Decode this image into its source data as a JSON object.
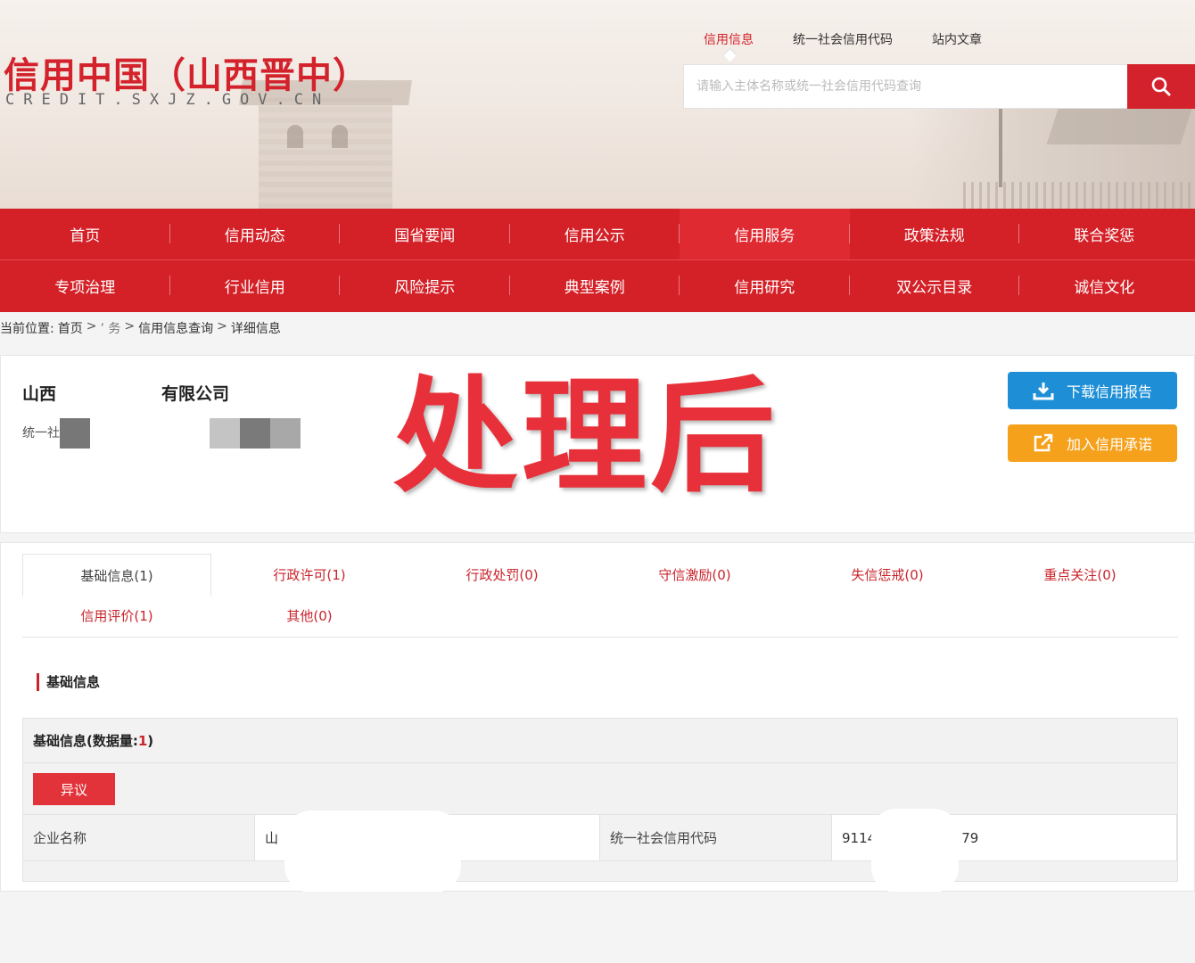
{
  "header": {
    "logo_title": "信用中国（山西晋中）",
    "logo_subtitle": "CREDIT.SXJZ.GOV.CN",
    "search_tabs": [
      "信用信息",
      "统一社会信用代码",
      "站内文章"
    ],
    "search_placeholder": "请输入主体名称或统一社会信用代码查询",
    "search_icon": "search-icon"
  },
  "nav": {
    "row1": [
      "首页",
      "信用动态",
      "国省要闻",
      "信用公示",
      "信用服务",
      "政策法规",
      "联合奖惩"
    ],
    "row2": [
      "专项治理",
      "行业信用",
      "风险提示",
      "典型案例",
      "信用研究",
      "双公示目录",
      "诚信文化"
    ],
    "active": "信用服务"
  },
  "breadcrumb": {
    "prefix": "当前位置:",
    "items": [
      "首页",
      "信用服务",
      "信用信息查询",
      "详细信息"
    ],
    "partial_item": "’ 务"
  },
  "company": {
    "name_start": "山西",
    "name_end": "有限公司",
    "code_label": "统一社",
    "watermark": "处理后",
    "download_button": "下载信用报告",
    "commit_button": "加入信用承诺"
  },
  "tabs": [
    {
      "label": "基础信息(1)",
      "active": true
    },
    {
      "label": "行政许可(1)"
    },
    {
      "label": "行政处罚(0)"
    },
    {
      "label": "守信激励(0)"
    },
    {
      "label": "失信惩戒(0)"
    },
    {
      "label": "重点关注(0)"
    },
    {
      "label": "信用评价(1)"
    },
    {
      "label": "其他(0)"
    }
  ],
  "basic_info": {
    "section_title": "基础信息",
    "block_title": "基础信息(数据量:",
    "block_count": "1",
    "block_close": ")",
    "dispute_button": "异议",
    "row": {
      "name_label": "企业名称",
      "name_value_start": "山",
      "code_label": "统一社会信用代码",
      "code_value_start": "9114",
      "code_value_end": "79"
    }
  },
  "colors": {
    "brand_red": "#d42027",
    "download_blue": "#1e8fd6",
    "commit_orange": "#f5a11b"
  }
}
